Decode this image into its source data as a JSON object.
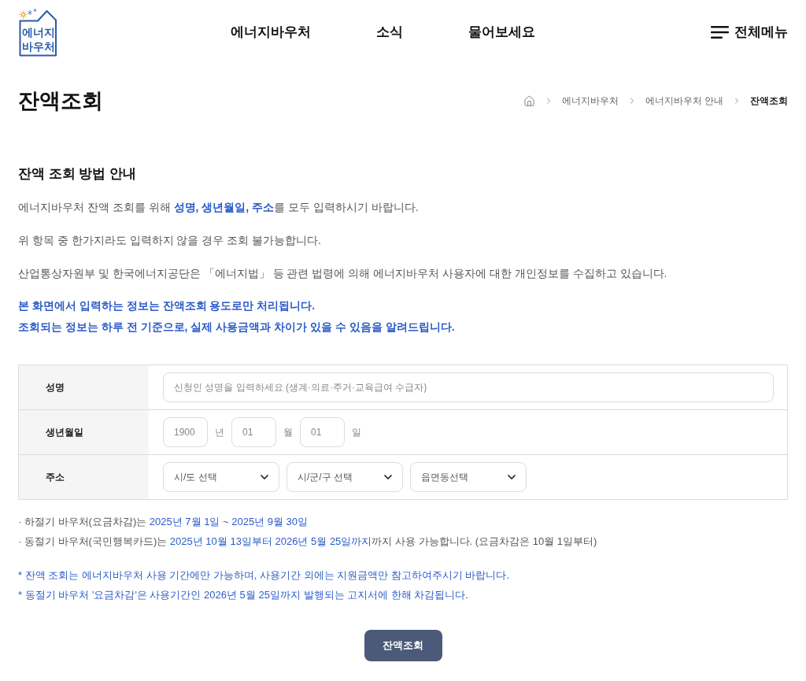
{
  "header": {
    "logo": {
      "lines": [
        "에너지",
        "바우처"
      ]
    },
    "nav": [
      {
        "label": "에너지바우처"
      },
      {
        "label": "소식"
      },
      {
        "label": "물어보세요"
      }
    ],
    "all_menu": "전체메뉴"
  },
  "page_title": "잔액조회",
  "breadcrumb": [
    {
      "label": "에너지바우처",
      "current": false
    },
    {
      "label": "에너지바우처 안내",
      "current": false
    },
    {
      "label": "잔액조회",
      "current": true
    }
  ],
  "guide": {
    "heading": "잔액 조회 방법 안내",
    "paragraphs": [
      "에너지바우처 잔액 조회를 위해 **성명, 생년월일, 주소**를 모두 입력하시기 바랍니다.",
      "위 항목 중 한가지라도 입력하지 않을 경우 조회 불가능합니다.",
      "산업통상자원부 및 한국에너지공단은 「에너지법」 등 관련 법령에 의해 에너지바우처 사용자에 대한 개인정보를 수집하고 있습니다."
    ],
    "notice": [
      "본 화면에서 입력하는 정보는 잔액조회 용도로만 처리됩니다.",
      "조회되는 정보는 하루 전 기준으로, 실제 사용금액과 차이가 있을 수 있음을 알려드립니다."
    ]
  },
  "form": {
    "rows": [
      {
        "kind": "text",
        "label": "성명",
        "placeholder": "신청인 성명을 입력하세요 (생계·의료·주거·교육급여 수급자)"
      },
      {
        "kind": "date",
        "label": "생년월일",
        "parts": [
          {
            "placeholder": "1900",
            "unit": "년"
          },
          {
            "placeholder": "01",
            "unit": "월"
          },
          {
            "placeholder": "01",
            "unit": "일"
          }
        ]
      },
      {
        "kind": "select",
        "label": "주소",
        "selects": [
          {
            "value": "시/도 선택"
          },
          {
            "value": "시/군/구 선택"
          },
          {
            "value": "읍면동선택"
          }
        ]
      }
    ]
  },
  "period_notes": [
    "· 하절기 바우처(요금차감)는 **2025년 7월 1일 ~ 2025년 9월 30일**",
    "· 동절기 바우처(국민행복카드)는 **2025년 10월 13일부터 2026년 5월 25일까지**까지 사용 가능합니다. (요금차감은 10월 1일부터)"
  ],
  "cautions": [
    "* 잔액 조회는 에너지바우처 사용 기간에만 가능하며, 사용기간 외에는 지원금액만 참고하여주시기 바랍니다.",
    "* 동절기 바우처 '요금차감'은 사용기간인 2026년 5월 25일까지 발행되는 고지서에 한해 차감됩니다."
  ],
  "submit_button": "잔액조회"
}
